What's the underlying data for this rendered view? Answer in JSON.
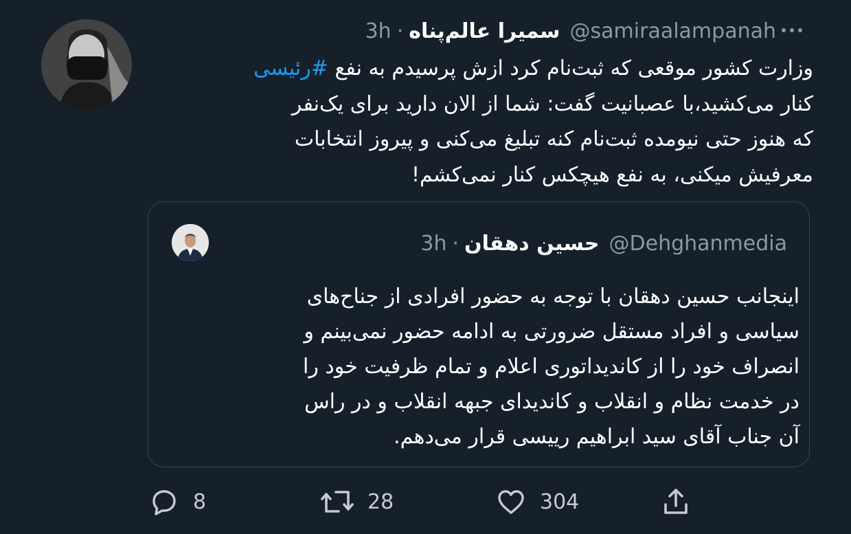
{
  "tweet": {
    "display_name": "سمیرا عالم‌پناه",
    "handle": "@samiraalampanah",
    "separator": "·",
    "time": "3h",
    "text_lines": [
      "وزارت کشور موقعی که ثبت‌نام کرد ازش پرسیدم به نفع",
      "کنار می‌کشید،با عصبانیت گفت: شما از الان دارید برای یک‌نفر",
      "که هنوز حتی نیومده ثبت‌نام کنه تبلیغ می‌کنی و پیروز انتخابات",
      "معرفیش میکنی، به نفع هیچکس کنار نمی‌کشم!"
    ],
    "hashtag": "#رئیسی",
    "more_icon": "more-horizontal-icon"
  },
  "quote": {
    "display_name": "حسین دهقان",
    "handle": "@Dehghanmedia",
    "separator": "·",
    "time": "3h",
    "text_lines": [
      "اینجانب حسین دهقان با توجه به حضور افرادی از جناح‌های",
      "سیاسی و افراد مستقل ضرورتی به ادامه حضور نمی‌بینم و",
      "انصراف خود را از کاندیداتوری اعلام و تمام ظرفیت خود را",
      "در خدمت نظام و انقلاب و کاندیدای جبهه انقلاب و در راس",
      "آن جناب آقای سید ابراهیم رییسی قرار می‌دهم."
    ]
  },
  "actions": {
    "reply": {
      "icon": "reply-icon",
      "count": "8"
    },
    "retweet": {
      "icon": "retweet-icon",
      "count": "28"
    },
    "like": {
      "icon": "heart-icon",
      "count": "304"
    },
    "share": {
      "icon": "share-icon"
    }
  },
  "colors": {
    "background": "#15202b",
    "text": "#ffffff",
    "secondary": "#8b98a5",
    "link": "#1d9bf0",
    "border": "#38444d"
  }
}
